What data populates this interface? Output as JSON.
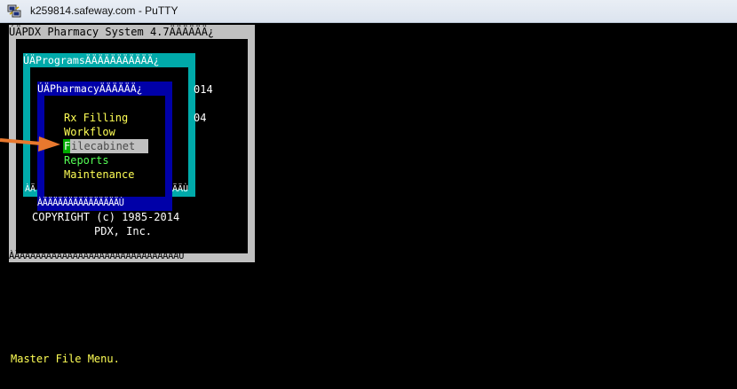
{
  "window": {
    "title": "k259814.safeway.com - PuTTY",
    "icon": "putty-icon"
  },
  "terminal": {
    "system_header": "ÚÄPDX Pharmacy System 4.7ÄÄÄÄÄÄ¿",
    "programs_header": "ÚÄProgramsÄÄÄÄÄÄÄÄÄÄÄ¿",
    "pharmacy_header": "ÚÄPharmacyÄÄÄÄÄÄ¿",
    "side_text_1": "014",
    "side_text_2": "04",
    "menu_items": [
      {
        "label": "Rx Filling",
        "color": "#ffff55"
      },
      {
        "label": "Workflow",
        "color": "#ffff55"
      },
      {
        "label": "Filecabinet",
        "hotkey": "F",
        "rest": "ilecabinet",
        "selected": true
      },
      {
        "label": "Reports",
        "color": "#55ff55"
      },
      {
        "label": "Maintenance",
        "color": "#ffff55"
      }
    ],
    "pharmacy_footer": "ÀÄÄÄÄÄÄÄÄÄÄÄÄÄÄÄÙ",
    "programs_footer_left": "ÀÄ",
    "programs_footer_right": "ÄÄÙ",
    "copyright": "COPYRIGHT (c) 1985-2014",
    "company": "PDX, Inc.",
    "system_footer": "ÀÄÄÄÄÄÄÄÄÄÄÄÄÄÄÄÄÄÄÄÄÄÄÄÄÄÄÄÄÄÄÄÙ",
    "status_line": "Master File Menu.",
    "border_glyph": "³"
  },
  "colors": {
    "terminal_bg": "#000000",
    "outer_box": "#c0c0c0",
    "programs_box": "#00aaaa",
    "pharmacy_box": "#0000a8",
    "menu_yellow": "#ffff55",
    "menu_green": "#55ff55",
    "status_yellow": "#ffff55",
    "arrow": "#e8782e"
  }
}
